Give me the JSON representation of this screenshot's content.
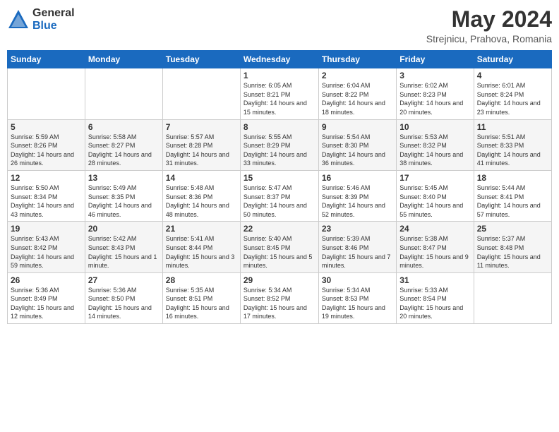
{
  "header": {
    "logo": {
      "general": "General",
      "blue": "Blue"
    },
    "title": "May 2024",
    "location": "Strejnicu, Prahova, Romania"
  },
  "weekdays": [
    "Sunday",
    "Monday",
    "Tuesday",
    "Wednesday",
    "Thursday",
    "Friday",
    "Saturday"
  ],
  "weeks": [
    [
      {
        "day": "",
        "info": ""
      },
      {
        "day": "",
        "info": ""
      },
      {
        "day": "",
        "info": ""
      },
      {
        "day": "1",
        "info": "Sunrise: 6:05 AM\nSunset: 8:21 PM\nDaylight: 14 hours and 15 minutes."
      },
      {
        "day": "2",
        "info": "Sunrise: 6:04 AM\nSunset: 8:22 PM\nDaylight: 14 hours and 18 minutes."
      },
      {
        "day": "3",
        "info": "Sunrise: 6:02 AM\nSunset: 8:23 PM\nDaylight: 14 hours and 20 minutes."
      },
      {
        "day": "4",
        "info": "Sunrise: 6:01 AM\nSunset: 8:24 PM\nDaylight: 14 hours and 23 minutes."
      }
    ],
    [
      {
        "day": "5",
        "info": "Sunrise: 5:59 AM\nSunset: 8:26 PM\nDaylight: 14 hours and 26 minutes."
      },
      {
        "day": "6",
        "info": "Sunrise: 5:58 AM\nSunset: 8:27 PM\nDaylight: 14 hours and 28 minutes."
      },
      {
        "day": "7",
        "info": "Sunrise: 5:57 AM\nSunset: 8:28 PM\nDaylight: 14 hours and 31 minutes."
      },
      {
        "day": "8",
        "info": "Sunrise: 5:55 AM\nSunset: 8:29 PM\nDaylight: 14 hours and 33 minutes."
      },
      {
        "day": "9",
        "info": "Sunrise: 5:54 AM\nSunset: 8:30 PM\nDaylight: 14 hours and 36 minutes."
      },
      {
        "day": "10",
        "info": "Sunrise: 5:53 AM\nSunset: 8:32 PM\nDaylight: 14 hours and 38 minutes."
      },
      {
        "day": "11",
        "info": "Sunrise: 5:51 AM\nSunset: 8:33 PM\nDaylight: 14 hours and 41 minutes."
      }
    ],
    [
      {
        "day": "12",
        "info": "Sunrise: 5:50 AM\nSunset: 8:34 PM\nDaylight: 14 hours and 43 minutes."
      },
      {
        "day": "13",
        "info": "Sunrise: 5:49 AM\nSunset: 8:35 PM\nDaylight: 14 hours and 46 minutes."
      },
      {
        "day": "14",
        "info": "Sunrise: 5:48 AM\nSunset: 8:36 PM\nDaylight: 14 hours and 48 minutes."
      },
      {
        "day": "15",
        "info": "Sunrise: 5:47 AM\nSunset: 8:37 PM\nDaylight: 14 hours and 50 minutes."
      },
      {
        "day": "16",
        "info": "Sunrise: 5:46 AM\nSunset: 8:39 PM\nDaylight: 14 hours and 52 minutes."
      },
      {
        "day": "17",
        "info": "Sunrise: 5:45 AM\nSunset: 8:40 PM\nDaylight: 14 hours and 55 minutes."
      },
      {
        "day": "18",
        "info": "Sunrise: 5:44 AM\nSunset: 8:41 PM\nDaylight: 14 hours and 57 minutes."
      }
    ],
    [
      {
        "day": "19",
        "info": "Sunrise: 5:43 AM\nSunset: 8:42 PM\nDaylight: 14 hours and 59 minutes."
      },
      {
        "day": "20",
        "info": "Sunrise: 5:42 AM\nSunset: 8:43 PM\nDaylight: 15 hours and 1 minute."
      },
      {
        "day": "21",
        "info": "Sunrise: 5:41 AM\nSunset: 8:44 PM\nDaylight: 15 hours and 3 minutes."
      },
      {
        "day": "22",
        "info": "Sunrise: 5:40 AM\nSunset: 8:45 PM\nDaylight: 15 hours and 5 minutes."
      },
      {
        "day": "23",
        "info": "Sunrise: 5:39 AM\nSunset: 8:46 PM\nDaylight: 15 hours and 7 minutes."
      },
      {
        "day": "24",
        "info": "Sunrise: 5:38 AM\nSunset: 8:47 PM\nDaylight: 15 hours and 9 minutes."
      },
      {
        "day": "25",
        "info": "Sunrise: 5:37 AM\nSunset: 8:48 PM\nDaylight: 15 hours and 11 minutes."
      }
    ],
    [
      {
        "day": "26",
        "info": "Sunrise: 5:36 AM\nSunset: 8:49 PM\nDaylight: 15 hours and 12 minutes."
      },
      {
        "day": "27",
        "info": "Sunrise: 5:36 AM\nSunset: 8:50 PM\nDaylight: 15 hours and 14 minutes."
      },
      {
        "day": "28",
        "info": "Sunrise: 5:35 AM\nSunset: 8:51 PM\nDaylight: 15 hours and 16 minutes."
      },
      {
        "day": "29",
        "info": "Sunrise: 5:34 AM\nSunset: 8:52 PM\nDaylight: 15 hours and 17 minutes."
      },
      {
        "day": "30",
        "info": "Sunrise: 5:34 AM\nSunset: 8:53 PM\nDaylight: 15 hours and 19 minutes."
      },
      {
        "day": "31",
        "info": "Sunrise: 5:33 AM\nSunset: 8:54 PM\nDaylight: 15 hours and 20 minutes."
      },
      {
        "day": "",
        "info": ""
      }
    ]
  ]
}
